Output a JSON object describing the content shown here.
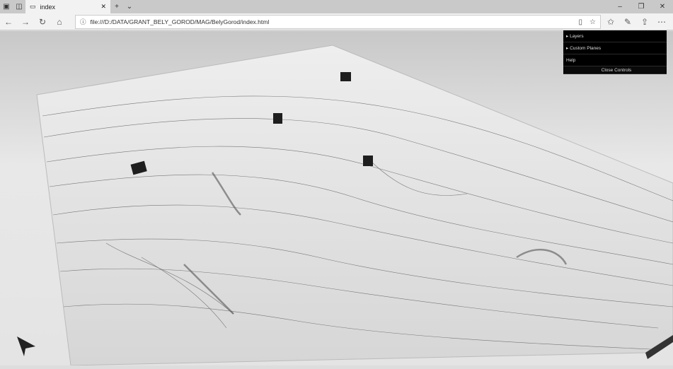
{
  "browser": {
    "tab_title": "index",
    "url": "file:///D:/DATA/GRANT_BELY_GOROD/MAG/BelyGorod/index.html"
  },
  "controls": {
    "items": [
      "▸ Layers",
      "▸ Custom Planes",
      "Help"
    ],
    "close_label": "Close Controls"
  }
}
